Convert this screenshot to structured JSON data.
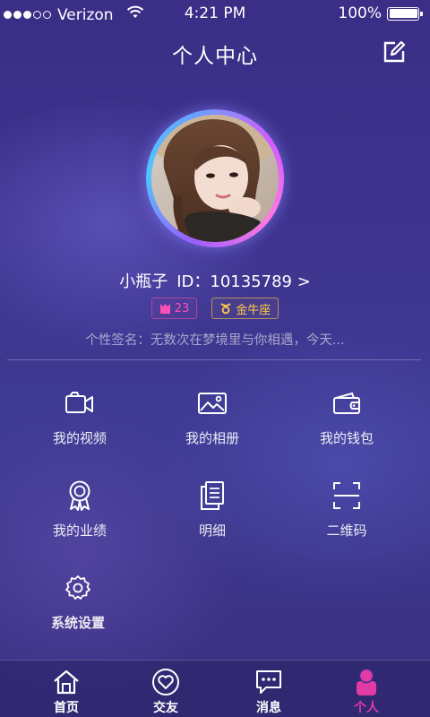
{
  "status_bar": {
    "carrier": "Verizon",
    "time": "4:21 PM",
    "battery": "100%",
    "battery_level": 1.0,
    "signal_bars": 3,
    "signal_total": 5
  },
  "header": {
    "title": "个人中心",
    "edit_icon": "edit-icon"
  },
  "profile": {
    "nickname": "小瓶子",
    "id_text": "ID：10135789 >",
    "level": "23",
    "zodiac": "金牛座",
    "signature": "个性签名：无数次在梦境里与你相遇，今天..."
  },
  "menu": {
    "videos": "我的视频",
    "albums": "我的相册",
    "wallet": "我的钱包",
    "performance": "我的业绩",
    "details": "明细",
    "qrcode": "二维码",
    "settings": "系统设置"
  },
  "tabs": {
    "home": "首页",
    "friends": "交友",
    "messages": "消息",
    "me": "个人"
  },
  "colors": {
    "accent": "#e23ba5",
    "level_badge": "#ff4fb6",
    "zodiac_badge": "#ffcc4a",
    "background": "#3e3590"
  }
}
